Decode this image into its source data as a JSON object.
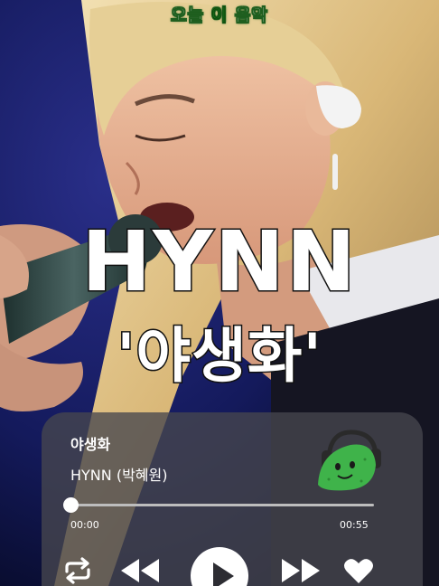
{
  "channel": {
    "part1": "오늘",
    "part2": "이",
    "part3": "음악"
  },
  "overlay": {
    "artist": "HYNN",
    "song": "'야생화'"
  },
  "player": {
    "song_title": "야생화",
    "artist": "HYNN (박혜원)",
    "progress": 0.0,
    "time_current": "00:00",
    "time_total": "00:55",
    "album_art": "cucumber-character-headphones-icon",
    "controls": [
      "repeat-icon",
      "previous-icon",
      "play-icon",
      "next-icon",
      "heart-icon"
    ]
  },
  "colors": {
    "badge_green": "#37c23b",
    "card_bg": "#46464e",
    "cucumber": "#3fb34a",
    "stage_blue": "#12185a"
  }
}
